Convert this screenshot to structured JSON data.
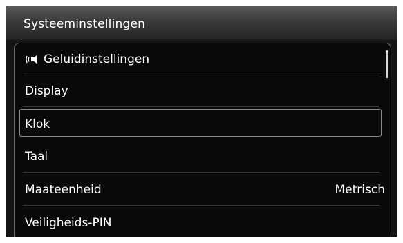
{
  "header": {
    "title": "Systeeminstellingen"
  },
  "menu": {
    "items": [
      {
        "label": "Geluidinstellingen",
        "icon": "speaker-sound-icon",
        "value": ""
      },
      {
        "label": "Display",
        "value": ""
      },
      {
        "label": "Klok",
        "value": "",
        "selected": true
      },
      {
        "label": "Taal",
        "value": ""
      },
      {
        "label": "Maateenheid",
        "value": "Metrisch"
      },
      {
        "label": "Veiligheids-PIN",
        "value": ""
      }
    ]
  },
  "colors": {
    "background": "#141414",
    "text": "#ffffff",
    "divider": "#3a3a3a",
    "selection_border": "#8a8a8a"
  }
}
